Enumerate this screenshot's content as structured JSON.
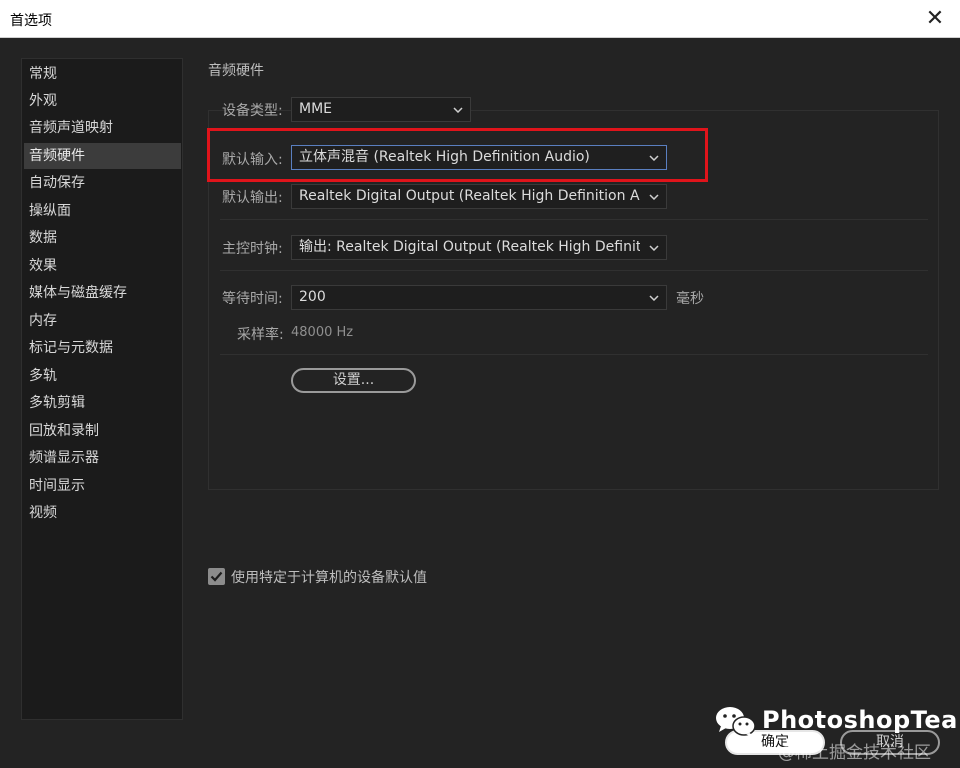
{
  "window": {
    "title": "首选项",
    "close_glyph": "✕"
  },
  "sidebar": {
    "items": [
      {
        "label": "常规"
      },
      {
        "label": "外观"
      },
      {
        "label": "音频声道映射"
      },
      {
        "label": "音频硬件",
        "active": true
      },
      {
        "label": "自动保存"
      },
      {
        "label": "操纵面"
      },
      {
        "label": "数据"
      },
      {
        "label": "效果"
      },
      {
        "label": "媒体与磁盘缓存"
      },
      {
        "label": "内存"
      },
      {
        "label": "标记与元数据"
      },
      {
        "label": "多轨"
      },
      {
        "label": "多轨剪辑"
      },
      {
        "label": "回放和录制"
      },
      {
        "label": "频谱显示器"
      },
      {
        "label": "时间显示"
      },
      {
        "label": "视频"
      }
    ]
  },
  "main": {
    "section_title": "音频硬件",
    "device_type": {
      "label": "设备类型:",
      "value": "MME"
    },
    "default_input": {
      "label": "默认输入:",
      "value": "立体声混音 (Realtek High Definition Audio)"
    },
    "default_output": {
      "label": "默认输出:",
      "value": "Realtek Digital Output (Realtek High Definition Audio)"
    },
    "master_clock": {
      "label": "主控时钟:",
      "value": "输出: Realtek Digital Output (Realtek High Definition ..."
    },
    "latency": {
      "label": "等待时间:",
      "value": "200",
      "unit": "毫秒"
    },
    "sample_rate": {
      "label": "采样率:",
      "value": "48000 Hz"
    },
    "settings_button": "设置...",
    "use_defaults_checkbox": {
      "label": "使用特定于计算机的设备默认值",
      "checked": true
    }
  },
  "footer": {
    "ok_label": "确定",
    "cancel_label": "取消"
  },
  "watermarks": {
    "brand": "PhotoshopTea",
    "juejin": "@稀土掘金技术社区"
  },
  "colors": {
    "highlight": "#e0141b",
    "background": "#232323",
    "sidebar_active": "#3c3c3c"
  },
  "icons": [
    "close-icon",
    "chevron-down-icon",
    "checkmark-icon",
    "wechat-icon"
  ]
}
